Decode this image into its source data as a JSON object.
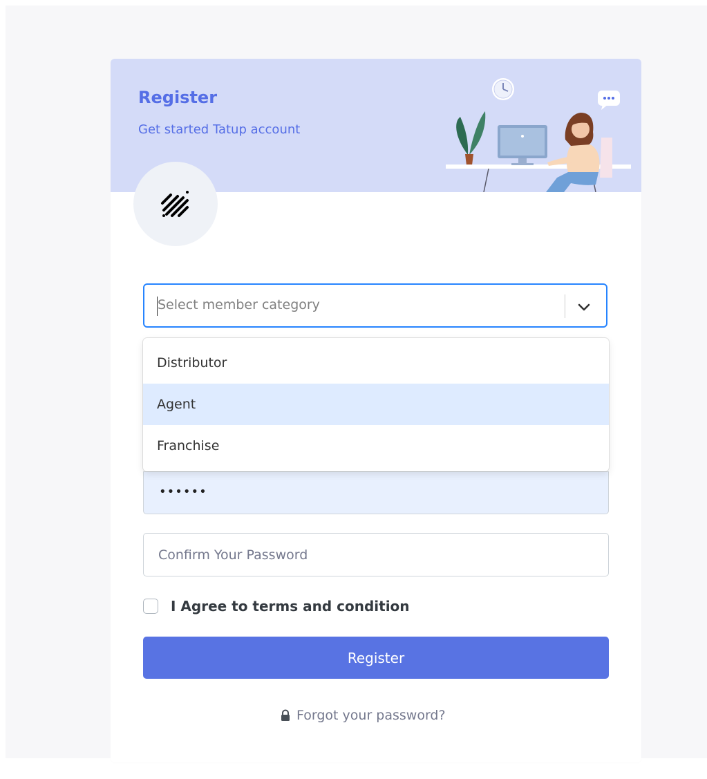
{
  "banner": {
    "title": "Register",
    "subtitle": "Get started Tatup account",
    "illustration_icon": "person-at-desk-illustration",
    "logo_icon": "diagonal-stripes-logo-icon"
  },
  "form": {
    "category_select": {
      "placeholder": "Select member category",
      "chevron_icon": "chevron-down-icon",
      "options": [
        {
          "label": "Distributor"
        },
        {
          "label": "Agent"
        },
        {
          "label": "Franchise"
        }
      ],
      "focused_option": "Agent"
    },
    "password_value": "••••••",
    "confirm_password_placeholder": "Confirm Your Password",
    "agree_label": "I Agree to terms and condition",
    "agree_checked": false,
    "register_label": "Register",
    "forgot_label": "Forgot your password?",
    "forgot_icon": "lock-icon"
  },
  "colors": {
    "accent": "#556ee6",
    "button": "#5873e3",
    "banner_bg": "#d4dbf8",
    "focus_border": "#2684ff",
    "option_focus": "#deebff",
    "autofill_bg": "#e8f0fe"
  }
}
